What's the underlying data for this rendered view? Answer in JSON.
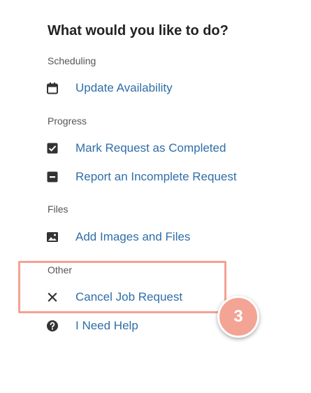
{
  "title": "What would you like to do?",
  "sections": {
    "scheduling": {
      "label": "Scheduling",
      "actions": [
        {
          "label": "Update Availability",
          "icon": "calendar-icon"
        }
      ]
    },
    "progress": {
      "label": "Progress",
      "actions": [
        {
          "label": "Mark Request as Completed",
          "icon": "checkbox-checked-icon"
        },
        {
          "label": "Report an Incomplete Request",
          "icon": "checkbox-indeterminate-icon"
        }
      ]
    },
    "files": {
      "label": "Files",
      "actions": [
        {
          "label": "Add Images and Files",
          "icon": "image-icon"
        }
      ]
    },
    "other": {
      "label": "Other",
      "actions": [
        {
          "label": "Cancel Job Request",
          "icon": "close-icon"
        },
        {
          "label": "I Need Help",
          "icon": "help-icon"
        }
      ]
    }
  },
  "annotation": {
    "step_number": "3",
    "color": "#f3a494"
  },
  "colors": {
    "link": "#2f6ea8",
    "icon": "#333333",
    "heading": "#222222",
    "section_label": "#555555"
  }
}
